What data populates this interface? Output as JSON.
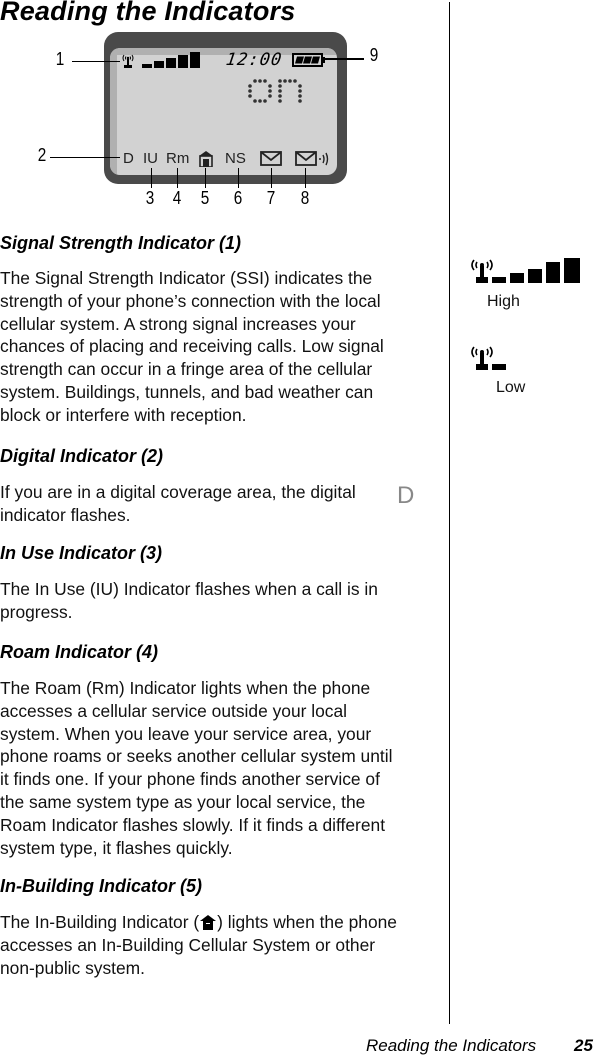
{
  "page": {
    "title": "Reading the Indicators",
    "footer_title": "Reading the Indicators",
    "page_number": "25"
  },
  "figure": {
    "lcd": {
      "time": "12:00",
      "status_text": "on",
      "signal_bars_lit": 5,
      "battery_segments_lit": 3,
      "bottom_indicators": [
        "D",
        "IU",
        "Rm",
        "in-building-icon",
        "NS",
        "message-icon",
        "voicemail-icon"
      ]
    },
    "callouts": [
      "1",
      "2",
      "3",
      "4",
      "5",
      "6",
      "7",
      "8",
      "9"
    ]
  },
  "sections": [
    {
      "heading": "Signal Strength Indicator (1)",
      "lines": [
        "The Signal Strength Indicator (SSI) indicates the",
        "strength of your phone’s connection with the local",
        "cellular system. A strong signal increases your",
        "chances of placing and receiving calls. Low signal",
        "strength can occur in a fringe area of the cellular",
        "system. Buildings, tunnels, and bad weather can",
        "block or interfere with reception."
      ]
    },
    {
      "heading": "Digital Indicator (2)",
      "lines": [
        "If you are in a digital coverage area, the digital",
        "indicator flashes."
      ],
      "inline_symbol": "D"
    },
    {
      "heading": "In Use Indicator (3)",
      "lines": [
        "The In Use (IU) Indicator flashes when a call is in",
        "progress."
      ]
    },
    {
      "heading": "Roam Indicator (4)",
      "lines": [
        "The Roam (Rm) Indicator lights when the phone",
        "accesses a cellular service outside your local",
        "system. When you leave your service area, your",
        "phone roams or seeks another cellular system until",
        "it finds one. If your phone finds another service of",
        "the same system type as your local service, the",
        "Roam Indicator flashes slowly. If it finds a different",
        "system type, it flashes quickly."
      ]
    },
    {
      "heading": "In-Building Indicator (5)",
      "lines": [
        "The In-Building Indicator (",
        "accesses an In-Building Cellular System or other",
        "non-public system."
      ],
      "line1_after_icon": ") lights when the phone"
    }
  ],
  "sidebar": {
    "high": {
      "label": "High",
      "bars_lit": 5
    },
    "low": {
      "label": "Low",
      "bars_lit": 1
    }
  }
}
